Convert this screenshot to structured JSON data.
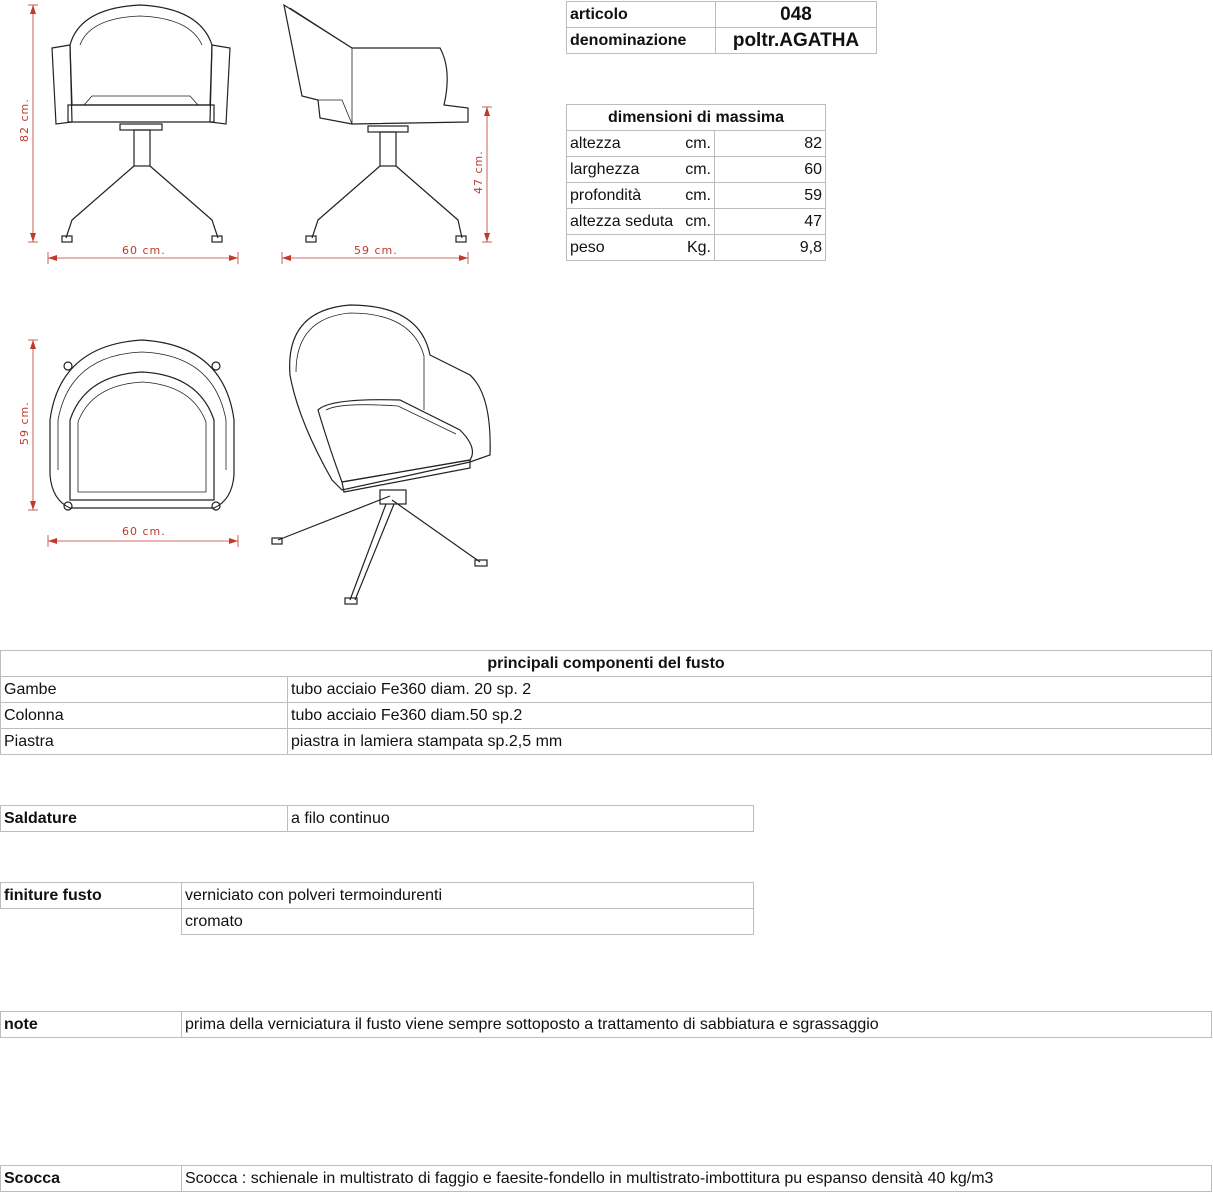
{
  "header": {
    "articolo_label": "articolo",
    "articolo_value": "048",
    "denominazione_label": "denominazione",
    "denominazione_value": "poltr.AGATHA"
  },
  "dimensioni": {
    "title": "dimensioni di massima",
    "rows": [
      {
        "label": "altezza",
        "unit": "cm.",
        "value": "82"
      },
      {
        "label": "larghezza",
        "unit": "cm.",
        "value": "60"
      },
      {
        "label": "profondità",
        "unit": "cm.",
        "value": "59"
      },
      {
        "label": "altezza seduta",
        "unit": "cm.",
        "value": "47"
      },
      {
        "label": "peso",
        "unit": "Kg.",
        "value": "9,8"
      }
    ]
  },
  "drawing_labels": {
    "front_height": "82 cm.",
    "front_width": "60 cm.",
    "side_depth": "59 cm.",
    "side_seat_height": "47 cm.",
    "top_depth": "59 cm.",
    "top_width": "60 cm."
  },
  "componenti": {
    "title": "principali componenti del fusto",
    "rows": [
      {
        "name": "Gambe",
        "desc": "tubo acciaio Fe360 diam. 20 sp. 2"
      },
      {
        "name": "Colonna",
        "desc": "tubo acciaio Fe360 diam.50 sp.2"
      },
      {
        "name": "Piastra",
        "desc": "piastra in lamiera stampata sp.2,5 mm"
      }
    ]
  },
  "saldature": {
    "label": "Saldature",
    "value": "a filo continuo"
  },
  "finiture": {
    "label": "finiture fusto",
    "values": [
      "verniciato con polveri termoindurenti",
      "cromato"
    ]
  },
  "note": {
    "label": "note",
    "value": "prima della verniciatura il fusto viene sempre sottoposto a trattamento di sabbiatura e sgrassaggio"
  },
  "scocca": {
    "label": "Scocca",
    "value": "Scocca : schienale in multistrato di faggio e faesite-fondello in multistrato-imbottitura pu espanso densità 40 kg/m3"
  }
}
